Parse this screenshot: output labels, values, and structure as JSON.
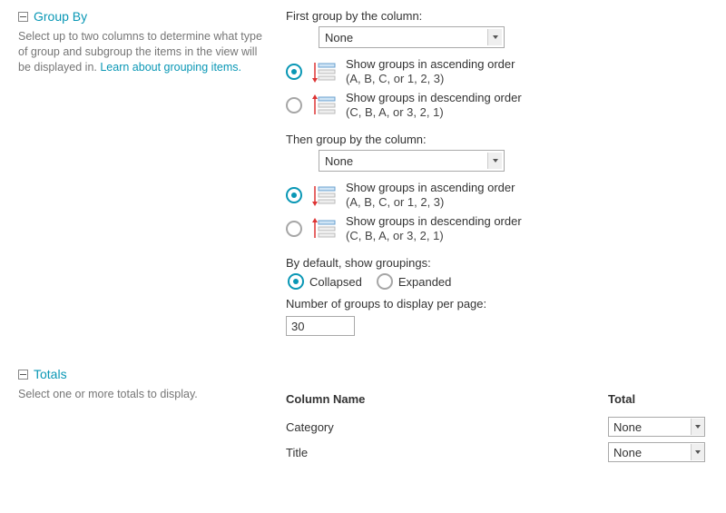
{
  "group_by": {
    "title": "Group By",
    "description": "Select up to two columns to determine what type of group and subgroup the items in the view will be displayed in. ",
    "link_text": "Learn about grouping items.",
    "first_label": "First group by the column:",
    "first_value": "None",
    "then_label": "Then group by the column:",
    "then_value": "None",
    "order_ascending_label": "Show groups in ascending order",
    "order_ascending_hint": "(A, B, C, or 1, 2, 3)",
    "order_descending_label": "Show groups in descending order",
    "order_descending_hint": "(C, B, A, or 3, 2, 1)",
    "default_label": "By default, show groupings:",
    "collapsed_label": "Collapsed",
    "expanded_label": "Expanded",
    "num_groups_label": "Number of groups to display per page:",
    "num_groups_value": "30"
  },
  "totals": {
    "title": "Totals",
    "description": "Select one or more totals to display.",
    "header_col": "Column Name",
    "header_total": "Total",
    "rows": [
      {
        "name": "Category",
        "total": "None"
      },
      {
        "name": "Title",
        "total": "None"
      }
    ]
  }
}
